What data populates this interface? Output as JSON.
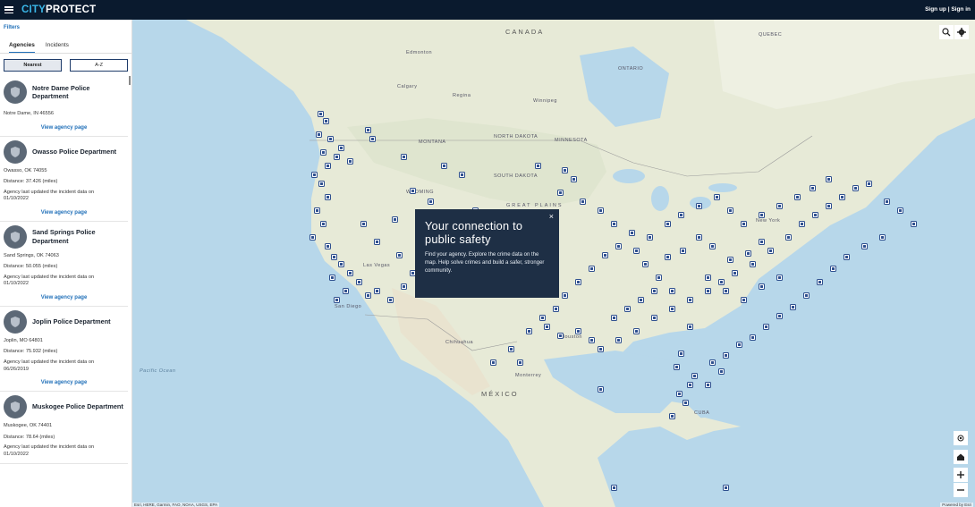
{
  "header": {
    "logo_city": "CITY",
    "logo_protect": "PROTECT",
    "auth_link": "Sign up | Sign in"
  },
  "sidebar": {
    "filters_label": "Filters",
    "tabs": [
      {
        "label": "Agencies",
        "active": true
      },
      {
        "label": "Incidents",
        "active": false
      }
    ],
    "sort": [
      {
        "label": "Nearest",
        "active": true
      },
      {
        "label": "A-Z",
        "active": false
      }
    ],
    "agencies": [
      {
        "name": "Notre Dame Police Department",
        "location": "Notre Dame, IN 46556",
        "distance": "",
        "updated_label": "",
        "updated_date": "",
        "view": "View agency page"
      },
      {
        "name": "Owasso Police Department",
        "location": "Owasso, OK 74055",
        "distance": "Distance: 37.426 (miles)",
        "updated_label": "Agency last updated the incident data on",
        "updated_date": "01/10/2022",
        "view": "View agency page"
      },
      {
        "name": "Sand Springs Police Department",
        "location": "Sand Springs, OK 74063",
        "distance": "Distance: 50.055 (miles)",
        "updated_label": "Agency last updated the incident data on",
        "updated_date": "01/10/2022",
        "view": "View agency page"
      },
      {
        "name": "Joplin Police Department",
        "location": "Joplin, MO 64801",
        "distance": "Distance: 75.932 (miles)",
        "updated_label": "Agency last updated the incident data on",
        "updated_date": "06/26/2019",
        "view": "View agency page"
      },
      {
        "name": "Muskogee Police Department",
        "location": "Muskogee, OK 74401",
        "distance": "Distance: 78.64 (miles)",
        "updated_label": "Agency last updated the incident data on",
        "updated_date": "01/10/2022",
        "view": ""
      }
    ]
  },
  "map": {
    "labels": {
      "canada": "CANADA",
      "mexico": "MÉXICO",
      "north_dakota": "NORTH DAKOTA",
      "south_dakota": "SOUTH DAKOTA",
      "montana": "MONTANA",
      "wyoming": "WYOMING",
      "minnesota": "MINNESOTA",
      "great_plains": "GREAT PLAINS",
      "ontario": "ONTARIO",
      "quebec": "QUEBEC",
      "pacific_ocean": "Pacific Ocean",
      "cuba": "CUBA",
      "chihuahua": "Chihuahua",
      "regina": "Regina",
      "calgary": "Calgary",
      "edmonton": "Edmonton",
      "winnipeg": "Winnipeg",
      "las_vegas": "Las Vegas",
      "san_diego": "San Diego",
      "monterrey": "Monterrey",
      "houston": "Houston",
      "new_york": "New York"
    },
    "tooltip": {
      "title": "Your connection to public safety",
      "body": "Find your agency. Explore the crime data on the map. Help solve crimes and build a safer, stronger community.",
      "close": "×"
    },
    "attribution": "Esri, HERE, Garmin, FAO, NOAA, USGS, EPA",
    "powered_by": "Powered by Esri",
    "pin_color": "#2e4f8e"
  }
}
